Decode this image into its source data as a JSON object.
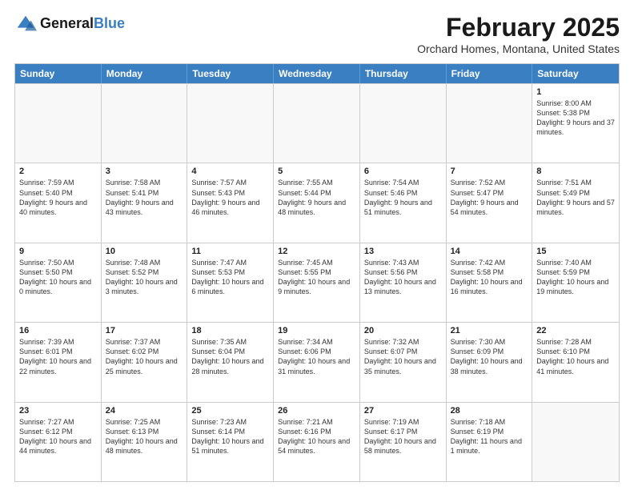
{
  "header": {
    "logo_line1": "General",
    "logo_line2": "Blue",
    "month_title": "February 2025",
    "location": "Orchard Homes, Montana, United States"
  },
  "days_of_week": [
    "Sunday",
    "Monday",
    "Tuesday",
    "Wednesday",
    "Thursday",
    "Friday",
    "Saturday"
  ],
  "weeks": [
    [
      {
        "day": "",
        "info": ""
      },
      {
        "day": "",
        "info": ""
      },
      {
        "day": "",
        "info": ""
      },
      {
        "day": "",
        "info": ""
      },
      {
        "day": "",
        "info": ""
      },
      {
        "day": "",
        "info": ""
      },
      {
        "day": "1",
        "info": "Sunrise: 8:00 AM\nSunset: 5:38 PM\nDaylight: 9 hours and 37 minutes."
      }
    ],
    [
      {
        "day": "2",
        "info": "Sunrise: 7:59 AM\nSunset: 5:40 PM\nDaylight: 9 hours and 40 minutes."
      },
      {
        "day": "3",
        "info": "Sunrise: 7:58 AM\nSunset: 5:41 PM\nDaylight: 9 hours and 43 minutes."
      },
      {
        "day": "4",
        "info": "Sunrise: 7:57 AM\nSunset: 5:43 PM\nDaylight: 9 hours and 46 minutes."
      },
      {
        "day": "5",
        "info": "Sunrise: 7:55 AM\nSunset: 5:44 PM\nDaylight: 9 hours and 48 minutes."
      },
      {
        "day": "6",
        "info": "Sunrise: 7:54 AM\nSunset: 5:46 PM\nDaylight: 9 hours and 51 minutes."
      },
      {
        "day": "7",
        "info": "Sunrise: 7:52 AM\nSunset: 5:47 PM\nDaylight: 9 hours and 54 minutes."
      },
      {
        "day": "8",
        "info": "Sunrise: 7:51 AM\nSunset: 5:49 PM\nDaylight: 9 hours and 57 minutes."
      }
    ],
    [
      {
        "day": "9",
        "info": "Sunrise: 7:50 AM\nSunset: 5:50 PM\nDaylight: 10 hours and 0 minutes."
      },
      {
        "day": "10",
        "info": "Sunrise: 7:48 AM\nSunset: 5:52 PM\nDaylight: 10 hours and 3 minutes."
      },
      {
        "day": "11",
        "info": "Sunrise: 7:47 AM\nSunset: 5:53 PM\nDaylight: 10 hours and 6 minutes."
      },
      {
        "day": "12",
        "info": "Sunrise: 7:45 AM\nSunset: 5:55 PM\nDaylight: 10 hours and 9 minutes."
      },
      {
        "day": "13",
        "info": "Sunrise: 7:43 AM\nSunset: 5:56 PM\nDaylight: 10 hours and 13 minutes."
      },
      {
        "day": "14",
        "info": "Sunrise: 7:42 AM\nSunset: 5:58 PM\nDaylight: 10 hours and 16 minutes."
      },
      {
        "day": "15",
        "info": "Sunrise: 7:40 AM\nSunset: 5:59 PM\nDaylight: 10 hours and 19 minutes."
      }
    ],
    [
      {
        "day": "16",
        "info": "Sunrise: 7:39 AM\nSunset: 6:01 PM\nDaylight: 10 hours and 22 minutes."
      },
      {
        "day": "17",
        "info": "Sunrise: 7:37 AM\nSunset: 6:02 PM\nDaylight: 10 hours and 25 minutes."
      },
      {
        "day": "18",
        "info": "Sunrise: 7:35 AM\nSunset: 6:04 PM\nDaylight: 10 hours and 28 minutes."
      },
      {
        "day": "19",
        "info": "Sunrise: 7:34 AM\nSunset: 6:06 PM\nDaylight: 10 hours and 31 minutes."
      },
      {
        "day": "20",
        "info": "Sunrise: 7:32 AM\nSunset: 6:07 PM\nDaylight: 10 hours and 35 minutes."
      },
      {
        "day": "21",
        "info": "Sunrise: 7:30 AM\nSunset: 6:09 PM\nDaylight: 10 hours and 38 minutes."
      },
      {
        "day": "22",
        "info": "Sunrise: 7:28 AM\nSunset: 6:10 PM\nDaylight: 10 hours and 41 minutes."
      }
    ],
    [
      {
        "day": "23",
        "info": "Sunrise: 7:27 AM\nSunset: 6:12 PM\nDaylight: 10 hours and 44 minutes."
      },
      {
        "day": "24",
        "info": "Sunrise: 7:25 AM\nSunset: 6:13 PM\nDaylight: 10 hours and 48 minutes."
      },
      {
        "day": "25",
        "info": "Sunrise: 7:23 AM\nSunset: 6:14 PM\nDaylight: 10 hours and 51 minutes."
      },
      {
        "day": "26",
        "info": "Sunrise: 7:21 AM\nSunset: 6:16 PM\nDaylight: 10 hours and 54 minutes."
      },
      {
        "day": "27",
        "info": "Sunrise: 7:19 AM\nSunset: 6:17 PM\nDaylight: 10 hours and 58 minutes."
      },
      {
        "day": "28",
        "info": "Sunrise: 7:18 AM\nSunset: 6:19 PM\nDaylight: 11 hours and 1 minute."
      },
      {
        "day": "",
        "info": ""
      }
    ]
  ]
}
